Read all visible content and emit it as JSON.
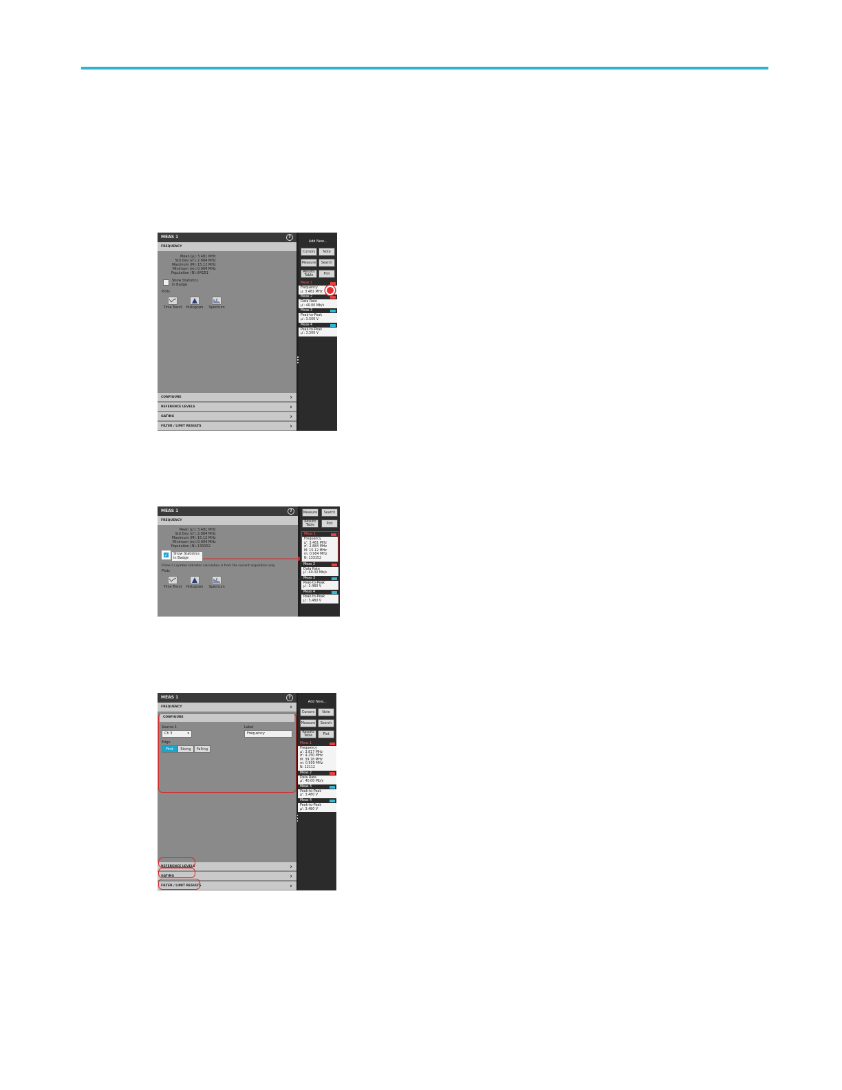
{
  "shots": [
    {
      "panel_title": "MEAS 1",
      "help": "?",
      "section": "FREQUENCY",
      "stats": [
        {
          "label": "Mean (μ):",
          "value": "3.481 MHz"
        },
        {
          "label": "Std Dev (σ'):",
          "value": "2.884 MHz"
        },
        {
          "label": "Maximum (M):",
          "value": "15.12 MHz"
        },
        {
          "label": "Minimum (m):",
          "value": "0.904 MHz"
        },
        {
          "label": "Population (N):",
          "value": "84151"
        }
      ],
      "checkbox_label": "Show Statistics in Badge",
      "plots_label": "Plots",
      "plot_buttons": [
        "Time Trend",
        "Histogram",
        "Spectrum"
      ],
      "footer_sections": [
        "CONFIGURE",
        "REFERENCE LEVELS",
        "GATING",
        "FILTER / LIMIT RESULTS"
      ],
      "side": {
        "add_new": "Add New...",
        "buttons": [
          [
            "Cursors",
            "Note"
          ],
          [
            "Measure",
            "Search"
          ],
          [
            "Results Table",
            "Plot"
          ]
        ],
        "badges": [
          {
            "name": "Meas 1",
            "lines": [
              "Frequency",
              "μ: 3.481 MHz"
            ]
          },
          {
            "name": "Meas 2",
            "lines": [
              "Data Rate",
              "μ': 40.00 Mb/s"
            ]
          },
          {
            "name": "Meas 3",
            "lines": [
              "Peak-to-Peak",
              "μ': 3.500 V"
            ]
          },
          {
            "name": "Meas 4",
            "lines": [
              "Peak-to-Peak",
              "μ': 3.500 V"
            ]
          }
        ]
      }
    },
    {
      "panel_title": "MEAS 1",
      "help": "?",
      "section": "FREQUENCY",
      "stats": [
        {
          "label": "Mean (μ'):",
          "value": "3.481 MHz"
        },
        {
          "label": "Std Dev (σ'):",
          "value": "2.884 MHz"
        },
        {
          "label": "Maximum (M):",
          "value": "15.12 MHz"
        },
        {
          "label": "Minimum (m):",
          "value": "0.904 MHz"
        },
        {
          "label": "Population (N):",
          "value": "133152"
        }
      ],
      "checkbox_label": "Show Statistics in Badge",
      "note": "Prime (') symbol indicates calculation is from the current acquisition only.",
      "plots_label": "Plots",
      "plot_buttons": [
        "Time Trend",
        "Histogram",
        "Spectrum"
      ],
      "side": {
        "buttons": [
          [
            "Measure",
            "Search"
          ],
          [
            "Results Table",
            "Plot"
          ]
        ],
        "badges": [
          {
            "name": "Meas 1",
            "lines": [
              "Frequency",
              "μ': 3.481 MHz",
              "σ': 2.884 MHz",
              "M: 15.12 MHz",
              "m: 0.904 MHz",
              "N: 133152"
            ]
          },
          {
            "name": "Meas 2",
            "lines": [
              "Data Rate",
              "μ': 40.00 Mb/s"
            ]
          },
          {
            "name": "Meas 3",
            "lines": [
              "Peak-to-Peak",
              "μ': 3.480 V"
            ]
          },
          {
            "name": "Meas 4",
            "lines": [
              "Peak-to-Peak",
              "μ': 3.480 V"
            ]
          }
        ]
      }
    },
    {
      "panel_title": "MEAS 1",
      "help": "?",
      "sections_top": [
        "FREQUENCY",
        "CONFIGURE"
      ],
      "source_label": "Source 1",
      "source_value": "Ch 3",
      "label_label": "Label",
      "label_value": "Frequency",
      "edge_label": "Edge",
      "edge_options": [
        "First",
        "Rising",
        "Falling"
      ],
      "footer_sections": [
        "REFERENCE LEVELS",
        "GATING",
        "FILTER / LIMIT RESULTS"
      ],
      "side": {
        "add_new": "Add New...",
        "buttons": [
          [
            "Cursors",
            "Note"
          ],
          [
            "Measure",
            "Search"
          ],
          [
            "Results Table",
            "Plot"
          ]
        ],
        "badges": [
          {
            "name": "Meas 1",
            "lines": [
              "Frequency",
              "μ': 3.817 MHz",
              "σ': 4.250 MHz",
              "M: 39.18 MHz",
              "m: 0.909 MHz",
              "N: 12112"
            ]
          },
          {
            "name": "Meas 2",
            "lines": [
              "Data Rate",
              "μ': 40.00 Mb/s"
            ]
          },
          {
            "name": "Meas 3",
            "lines": [
              "Peak-to-Peak",
              "μ': 3.480 V"
            ]
          },
          {
            "name": "Meas 4",
            "lines": [
              "Peak-to-Peak",
              "μ': 3.480 V"
            ]
          }
        ]
      }
    }
  ],
  "colors": {
    "accent_rule": "#2ab4d1",
    "highlight": "#d62b2b",
    "active": "#17a6cf"
  }
}
